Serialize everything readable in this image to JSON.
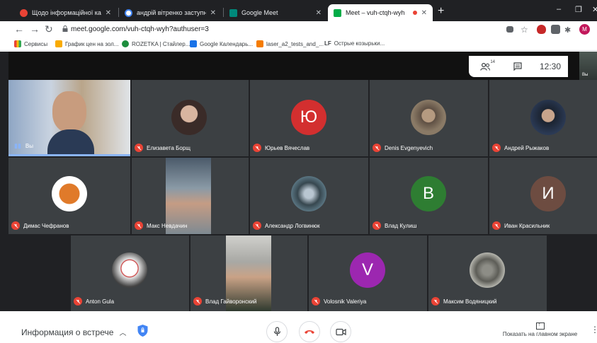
{
  "browser": {
    "tabs": [
      {
        "title": "Щодо інформаційної кампанії -",
        "favicon_color": "#e94335"
      },
      {
        "title": "андрій вітренко заступники - Г",
        "favicon_color": "#ffffff"
      },
      {
        "title": "Google Meet",
        "favicon_color": "#00897b"
      },
      {
        "title": "Meet – vuh-ctqh-wyh",
        "favicon_color": "#00ac47"
      }
    ],
    "new_tab_symbol": "+",
    "url": "meet.google.com/vuh-ctqh-wyh?authuser=3",
    "profile_initial": "M",
    "bookmarks": [
      {
        "label": "Сервисы",
        "icon_color": "#ea4335"
      },
      {
        "label": "График цен на зол...",
        "icon_color": "#f9ab00"
      },
      {
        "label": "ROZETKA | Стайлер...",
        "icon_color": "#1e8e3e"
      },
      {
        "label": "Google Календарь...",
        "icon_color": "#1a73e8"
      },
      {
        "label": "laser_a2_tests_and_...",
        "icon_color": "#f57c00"
      },
      {
        "label": "Острые козырьки...",
        "icon_color": "#202124",
        "prefix": "LF"
      }
    ]
  },
  "meet": {
    "participants_count": "14",
    "time": "12:30",
    "self_label": "Вы",
    "participants": [
      {
        "name": "Вы",
        "kind": "video-self",
        "muted": false
      },
      {
        "name": "Елизавета Борщ",
        "kind": "photo",
        "muted": true
      },
      {
        "name": "Юрьев Вячеслав",
        "kind": "letter",
        "letter": "Ю",
        "color": "#d32f2f",
        "muted": true
      },
      {
        "name": "Denis Evgenyevich",
        "kind": "photo",
        "muted": true
      },
      {
        "name": "Андрей Рыжаков",
        "kind": "photo",
        "muted": true
      },
      {
        "name": "Димас Чефранов",
        "kind": "photo",
        "muted": true
      },
      {
        "name": "Макс Невдачин",
        "kind": "video",
        "muted": true
      },
      {
        "name": "Александр Логвинюк",
        "kind": "photo",
        "muted": true
      },
      {
        "name": "Влад Кулиш",
        "kind": "letter",
        "letter": "В",
        "color": "#2e7d32",
        "muted": true
      },
      {
        "name": "Иван Красильник",
        "kind": "letter",
        "letter": "И",
        "color": "#6d4c41",
        "muted": true
      },
      {
        "name": "Anton Gula",
        "kind": "photo",
        "muted": true
      },
      {
        "name": "Влад Гайворонский",
        "kind": "video",
        "muted": true
      },
      {
        "name": "Volosnik Valeriya",
        "kind": "letter",
        "letter": "V",
        "color": "#9c27b0",
        "muted": true
      },
      {
        "name": "Максим Водяницкий",
        "kind": "photo",
        "muted": true
      }
    ]
  },
  "bottom": {
    "meeting_info": "Информация о встрече",
    "present_label": "Показать на главном экране"
  },
  "colors": {
    "mute_red": "#ea4335",
    "stage_bg": "#202124",
    "tile_bg": "#3c4043",
    "hangup": "#ea4335"
  }
}
